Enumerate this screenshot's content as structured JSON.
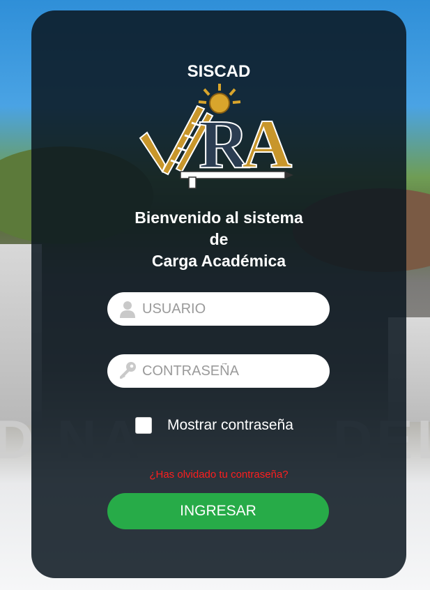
{
  "app": {
    "title": "SISCAD"
  },
  "logo": {
    "letters": "VRA",
    "icon": "vra-logo-icon"
  },
  "welcome": {
    "line1": "Bienvenido al sistema",
    "line2": "de",
    "line3": "Carga Académica"
  },
  "form": {
    "username_placeholder": "USUARIO",
    "username_icon": "user-icon",
    "password_placeholder": "CONTRASEÑA",
    "password_icon": "key-icon",
    "show_password_label": "Mostrar contraseña",
    "show_password_checked": false,
    "forgot_link": "¿Has olvidado tu contraseña?",
    "submit_label": "INGRESAR"
  },
  "background": {
    "sign_text_left": "D NA",
    "sign_text_right": "DEL"
  },
  "colors": {
    "card_bg": "#0a1620",
    "submit_green": "#27ab48",
    "forgot_red": "#ff1e1e",
    "logo_gold": "#c8962b",
    "logo_navy": "#2b3d52"
  }
}
